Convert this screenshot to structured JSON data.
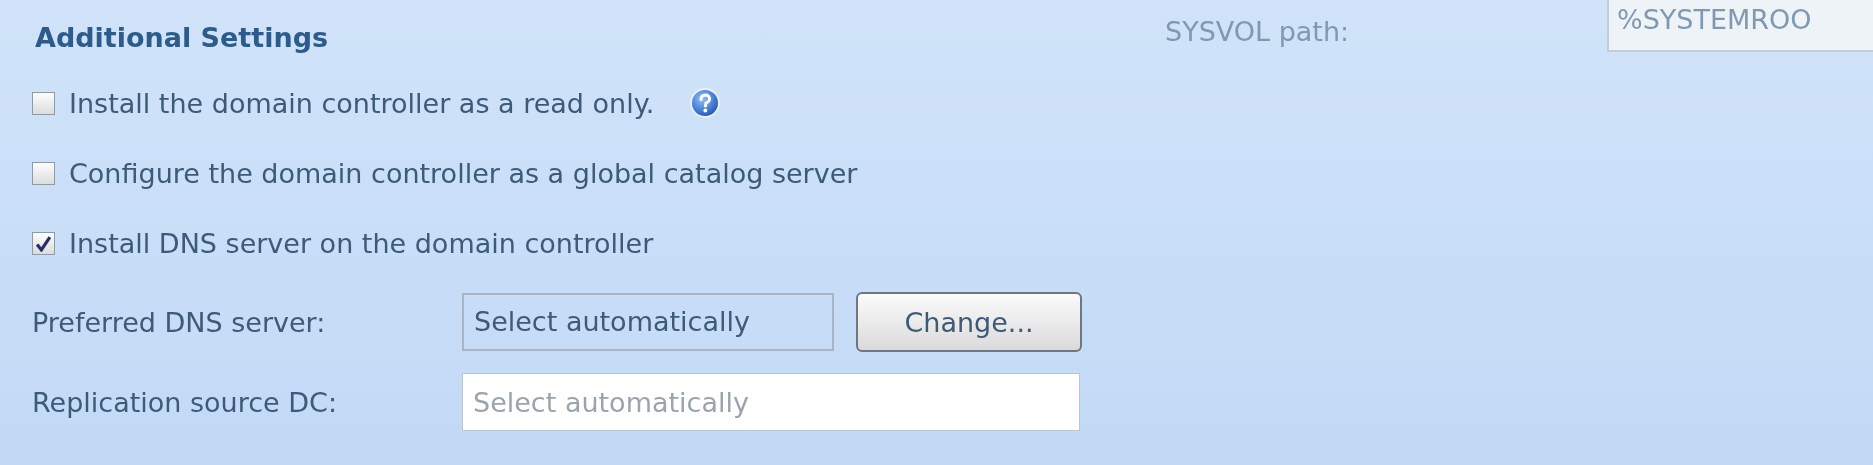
{
  "heading": "Additional Settings",
  "options": [
    {
      "label": "Install the domain controller as a read only.",
      "checked": false,
      "help": true
    },
    {
      "label": "Configure the domain controller as a global catalog server",
      "checked": false,
      "help": false
    },
    {
      "label": "Install DNS server on the domain controller",
      "checked": true,
      "help": false
    }
  ],
  "preferred_dns": {
    "label": "Preferred DNS server:",
    "value": "Select automatically",
    "button": "Change..."
  },
  "replication_source": {
    "label": "Replication source DC:",
    "placeholder": "Select automatically"
  },
  "sysvol": {
    "label": "SYSVOL path:",
    "value": "%SYSTEMROO",
    "disabled": true
  }
}
